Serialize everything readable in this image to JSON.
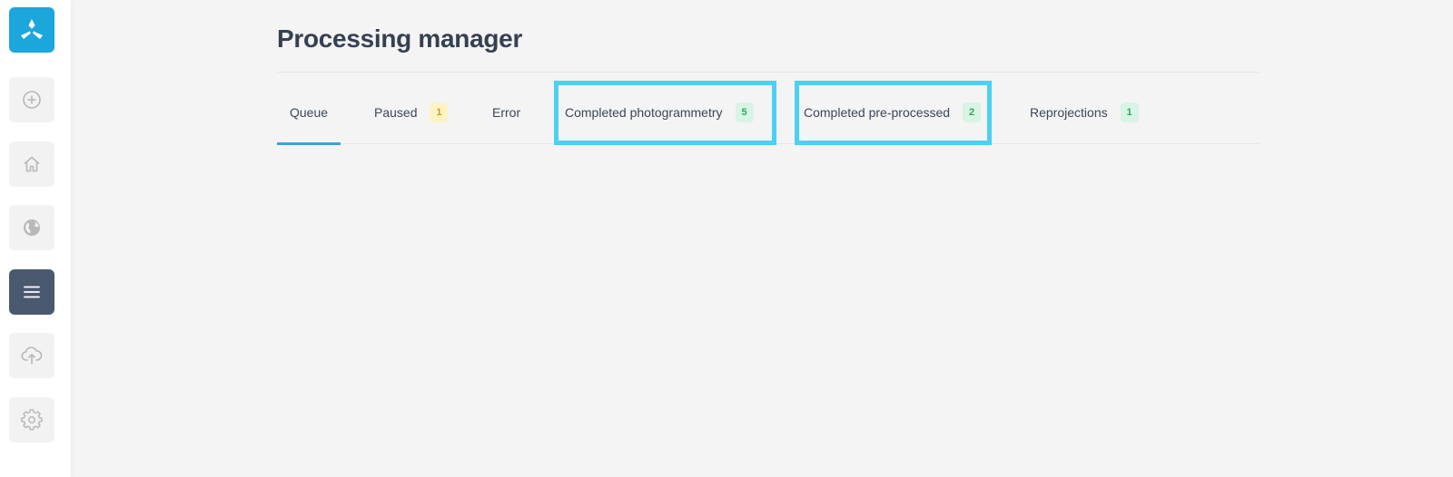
{
  "sidebar": {
    "items": [
      {
        "name": "logo",
        "icon": "app-logo-icon"
      },
      {
        "name": "add",
        "icon": "plus-circle-icon"
      },
      {
        "name": "home",
        "icon": "home-icon"
      },
      {
        "name": "globe",
        "icon": "globe-icon"
      },
      {
        "name": "processing",
        "icon": "menu-icon",
        "active": true
      },
      {
        "name": "upload",
        "icon": "cloud-upload-icon"
      },
      {
        "name": "settings",
        "icon": "gear-icon"
      }
    ]
  },
  "page": {
    "title": "Processing manager"
  },
  "tabs": [
    {
      "label": "Queue",
      "active": true
    },
    {
      "label": "Paused",
      "count": "1",
      "badge_color": "yellow"
    },
    {
      "label": "Error"
    },
    {
      "label": "Completed photogrammetry",
      "count": "5",
      "badge_color": "green",
      "highlighted": true
    },
    {
      "label": "Completed pre-processed",
      "count": "2",
      "badge_color": "green",
      "highlighted": true
    },
    {
      "label": "Reprojections",
      "count": "1",
      "badge_color": "green"
    }
  ],
  "colors": {
    "accent": "#1ba6dc",
    "active_sidebar": "#4a5870",
    "highlight": "#4cd0f4",
    "tab_underline": "#3aa3d9",
    "title": "#354052"
  }
}
